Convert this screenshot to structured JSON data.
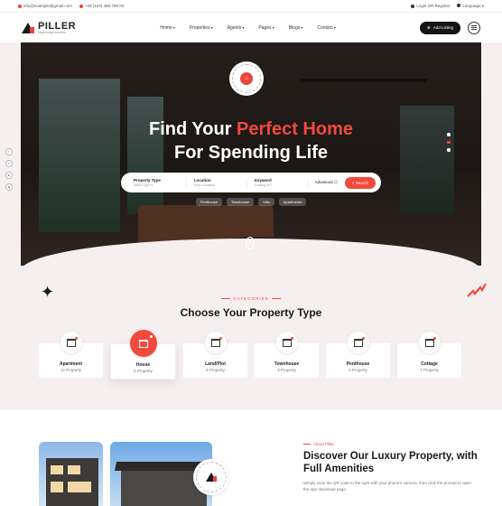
{
  "topbar": {
    "email": "info@example@gmail.com",
    "phone": "+28 (123) 456-789 00",
    "login": "Login OR Register",
    "language": "Language"
  },
  "brand": {
    "name": "PILLER",
    "tagline": "Real estate solution"
  },
  "menu": [
    "Home",
    "Properties",
    "Agents",
    "Pages",
    "Blogs",
    "Contact"
  ],
  "nav": {
    "add_listing": "Add Listing"
  },
  "hero": {
    "title_before": "Find Your ",
    "title_accent": "Perfect Home",
    "title_line2": "For Spending Life",
    "badge_text": "VILLA HOUSE · BEST HOME"
  },
  "search": {
    "fields": [
      {
        "label": "Property Type",
        "value": "Select Type"
      },
      {
        "label": "Location",
        "value": "Find a location"
      },
      {
        "label": "Keyword",
        "value": "Looking for?"
      }
    ],
    "advanced": "Advanced",
    "button": "Search"
  },
  "chips": [
    "Penthouse",
    "Townhouse",
    "Villa",
    "Apartments"
  ],
  "social": [
    "f",
    "t",
    "in",
    "ig"
  ],
  "categories": {
    "tag": "CATEGORIES",
    "title": "Choose Your Property Type",
    "items": [
      {
        "name": "Apartment",
        "count": "12 Property",
        "icon": "apartment-icon",
        "active": false
      },
      {
        "name": "House",
        "count": "5 Property",
        "icon": "house-icon",
        "active": true
      },
      {
        "name": "Land/Plot",
        "count": "8 Property",
        "icon": "land-icon",
        "active": false
      },
      {
        "name": "Townhouse",
        "count": "3 Property",
        "icon": "townhouse-icon",
        "active": false
      },
      {
        "name": "Penthouse",
        "count": "1 Property",
        "icon": "penthouse-icon",
        "active": false
      },
      {
        "name": "Cottage",
        "count": "7 Property",
        "icon": "cottage-icon",
        "active": false
      }
    ]
  },
  "about": {
    "tag": "About Piller",
    "title": "Discover Our Luxury Property, with Full Amenities",
    "text": "Simply scan the QR code to the right with your phone's camera, then click the prompt to open the app download page."
  },
  "colors": {
    "accent": "#f04a3c",
    "dark": "#141414"
  }
}
